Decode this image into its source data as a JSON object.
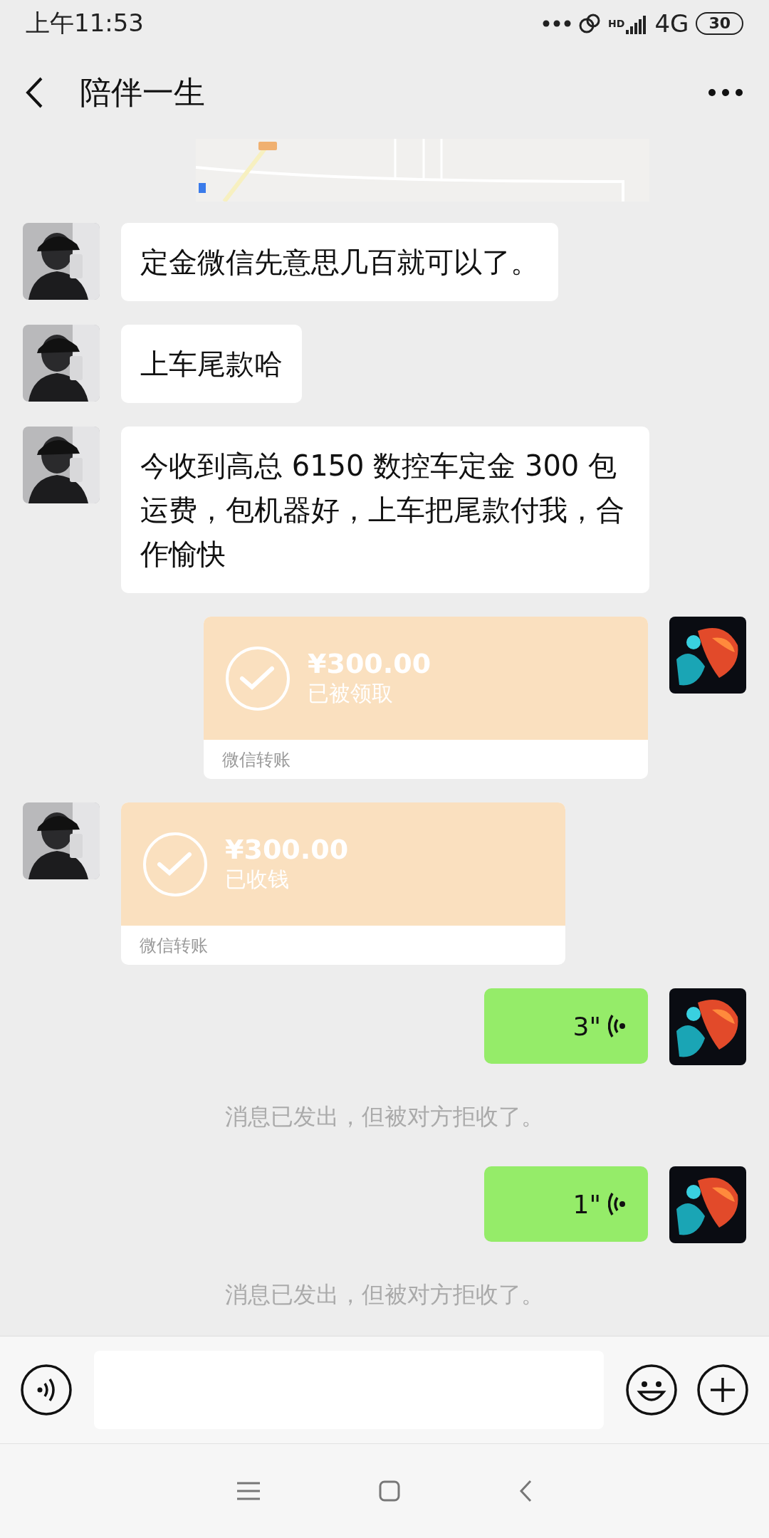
{
  "status_bar": {
    "time": "上午11:53",
    "network_badge": "HD",
    "network": "4G",
    "battery": "30"
  },
  "header": {
    "title": "陪伴一生"
  },
  "messages": [
    {
      "kind": "text",
      "outgoing": false,
      "text": "定金微信先意思几百就可以了。"
    },
    {
      "kind": "text",
      "outgoing": false,
      "text": "上车尾款哈"
    },
    {
      "kind": "text",
      "outgoing": false,
      "text": "今收到高总 6150 数控车定金 300 包运费，包机器好，上车把尾款付我，合作愉快"
    },
    {
      "kind": "transfer",
      "outgoing": true,
      "amount": "¥300.00",
      "status": "已被领取",
      "footer": "微信转账"
    },
    {
      "kind": "transfer",
      "outgoing": false,
      "amount": "¥300.00",
      "status": "已收钱",
      "footer": "微信转账"
    },
    {
      "kind": "voice",
      "outgoing": true,
      "duration": "3\""
    },
    {
      "kind": "notice",
      "text": "消息已发出，但被对方拒收了。"
    },
    {
      "kind": "voice",
      "outgoing": true,
      "duration": "1\""
    },
    {
      "kind": "notice",
      "text": "消息已发出，但被对方拒收了。"
    }
  ]
}
